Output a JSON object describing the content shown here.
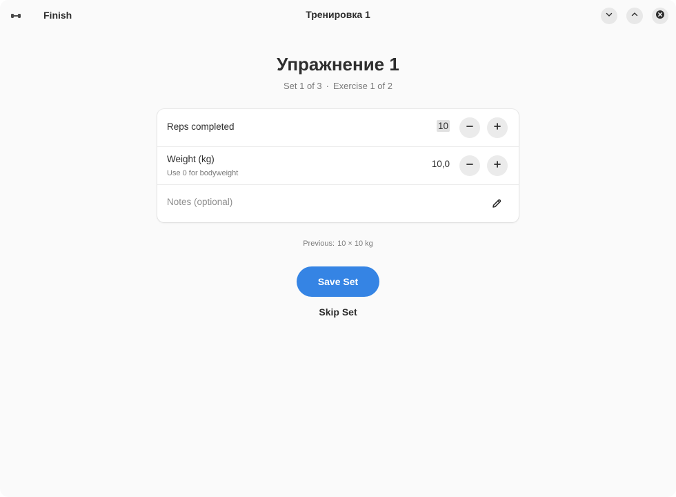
{
  "header": {
    "app_icon": "dumbbell-icon",
    "finish_label": "Finish",
    "title": "Тренировка 1",
    "window_controls": [
      "chevron-down-icon",
      "chevron-up-icon",
      "close-icon"
    ]
  },
  "exercise": {
    "name": "Упражнение 1",
    "set_progress": "Set 1 of 3",
    "separator": "·",
    "exercise_progress": "Exercise 1 of 2"
  },
  "form": {
    "reps": {
      "label": "Reps completed",
      "value": "10"
    },
    "weight": {
      "label": "Weight (kg)",
      "hint": "Use 0 for bodyweight",
      "value": "10,0"
    },
    "notes": {
      "placeholder": "Notes (optional)",
      "icon": "pencil-icon"
    }
  },
  "previous": {
    "label": "Previous:",
    "value": "10 × 10 kg"
  },
  "actions": {
    "save_label": "Save Set",
    "skip_label": "Skip Set"
  },
  "colors": {
    "accent": "#3584e4",
    "background": "#fafafa",
    "card": "#ffffff"
  }
}
